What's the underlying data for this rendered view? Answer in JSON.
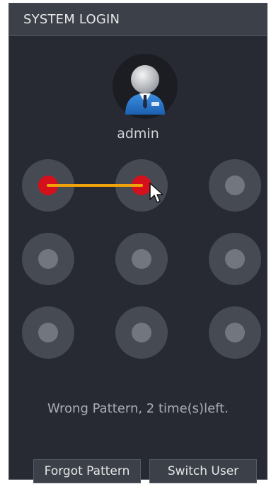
{
  "dialog": {
    "title": "SYSTEM LOGIN",
    "username": "admin",
    "message": "Wrong Pattern, 2 time(s)left."
  },
  "pattern": {
    "grid": [
      [
        true,
        true,
        false
      ],
      [
        false,
        false,
        false
      ],
      [
        false,
        false,
        false
      ]
    ]
  },
  "buttons": {
    "forgot_label": "Forgot Pattern",
    "switch_label": "Switch User"
  },
  "colors": {
    "background": "#272a32",
    "titlebar": "#3b4049",
    "dot_outer": "#464a53",
    "dot_inner": "#72767e",
    "dot_active": "#d3101b",
    "line": "#f0a30a"
  },
  "icons": {
    "avatar": "user-avatar-icon",
    "cursor": "mouse-pointer-icon"
  }
}
